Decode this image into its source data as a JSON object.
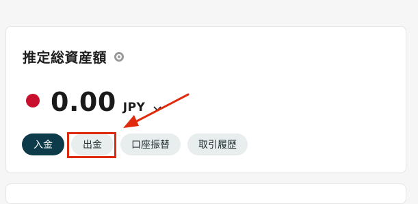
{
  "card": {
    "title": "推定総資産額",
    "balance": {
      "amount": "0.00",
      "currency": "JPY"
    },
    "actions": [
      {
        "label": "入金"
      },
      {
        "label": "出金"
      },
      {
        "label": "口座振替"
      },
      {
        "label": "取引履歴"
      }
    ]
  },
  "icons": {
    "visibility": "eye-icon",
    "flag": "japan-flag-icon",
    "currency_dropdown": "chevron-down-icon"
  },
  "colors": {
    "primary_button": "#0e3b4a",
    "secondary_button": "#e8eeed",
    "flag_red": "#c8102e",
    "annotation": "#e02a0e"
  }
}
